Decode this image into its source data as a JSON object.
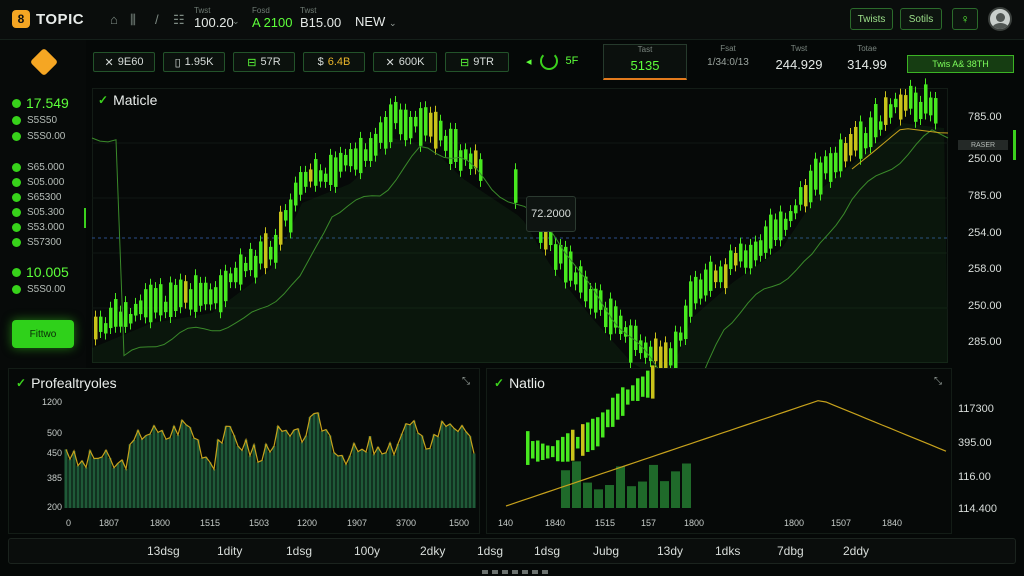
{
  "topbar": {
    "logo_text": "TOPIC",
    "values": [
      {
        "label": "Twst",
        "value": "100.20",
        "green": false
      },
      {
        "label": "Fosd",
        "value": "A 2100",
        "green": true
      },
      {
        "label": "Twst",
        "value": "B15.00",
        "green": false
      }
    ],
    "new_label": "NEW",
    "buttons": [
      "Twists",
      "Sotils"
    ]
  },
  "sidebar": {
    "top_value": "17.549",
    "group1": [
      "S5S50",
      "S5S0.00",
      "S5S0.00"
    ],
    "group2": [
      "S65.000",
      "S05.000",
      "S65300",
      "S05.300",
      "S53.000",
      "S57300"
    ],
    "mid_value": "10.005",
    "mid_sub": "S5S0.00",
    "action_label": "Fittwo"
  },
  "tickers": [
    {
      "icon": "✕",
      "text": "9E60"
    },
    {
      "icon": "▯",
      "text": "1.95K"
    },
    {
      "icon": "⊟",
      "text": "57R"
    },
    {
      "icon": "$",
      "text": "6.4B"
    },
    {
      "icon": "✕",
      "text": "600K"
    },
    {
      "icon": "⊟",
      "text": "9TR"
    }
  ],
  "ticker_arrow": "◂",
  "ticker_spin_text": "5F",
  "stats": [
    {
      "label": "Tast",
      "value": "5135",
      "active": true
    },
    {
      "label": "Fsat",
      "value": "1/34:0/13",
      "active": false
    },
    {
      "label": "Twst",
      "value": "244.929",
      "active": false
    },
    {
      "label": "Totae",
      "value": "314.99",
      "active": false
    }
  ],
  "ticker_end": "Twis A& 38TH",
  "main_chart": {
    "title": "Maticle",
    "tooltip": "72.2000",
    "y_labels": [
      "785.00",
      "250.00",
      "785.00",
      "254.00",
      "258.00",
      "250.00",
      "285.00"
    ],
    "right_marker": "RASER"
  },
  "bottom_left": {
    "title": "Profealtryoles",
    "y_labels": [
      "1200",
      "500",
      "450",
      "385",
      "200"
    ],
    "x_labels": [
      "0",
      "1807",
      "1800",
      "1515",
      "1503",
      "1200",
      "1907",
      "3700",
      "1500"
    ]
  },
  "bottom_right": {
    "title": "Natlio",
    "y_labels": [
      "117300",
      "395.00",
      "116.00",
      "114.400"
    ],
    "x_labels": [
      "140",
      "1840",
      "1515",
      "157",
      "1800",
      "1800",
      "1507",
      "1840"
    ]
  },
  "timeframes": [
    "13dsg",
    "1dity",
    "1dsg",
    "100y",
    "2dky",
    "1dsg",
    "1dsg",
    "Jubg",
    "13dy",
    "1dks",
    "7dbg",
    "2ddy"
  ],
  "colors": {
    "accent": "#5dff3a",
    "candle": "#47e81f",
    "line": "#c7a21c",
    "bg": "#050807"
  }
}
